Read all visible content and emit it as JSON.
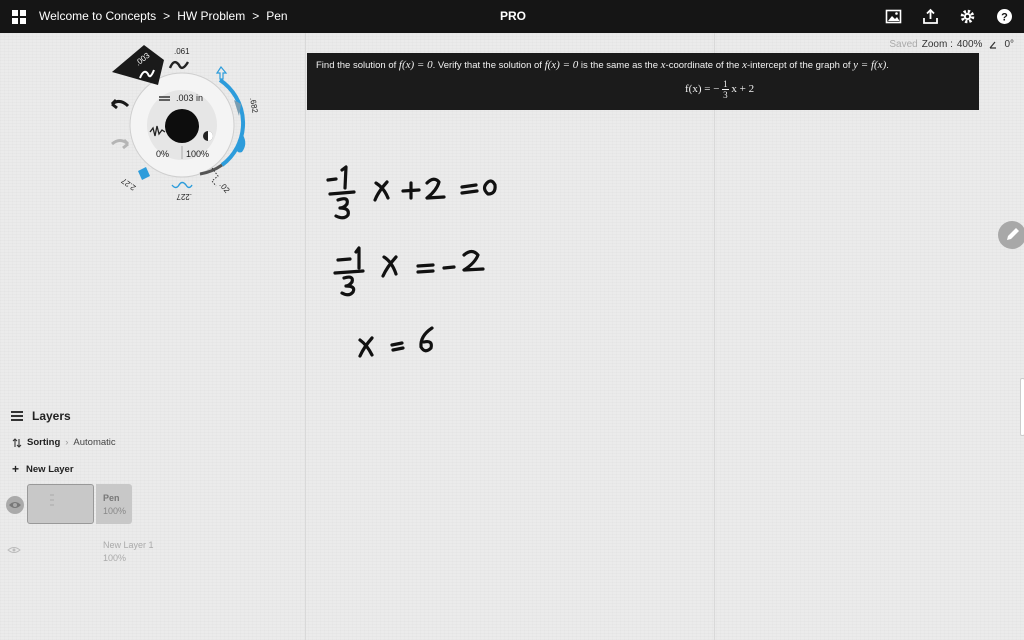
{
  "topbar": {
    "breadcrumb": [
      "Welcome to Concepts",
      "HW Problem",
      "Pen"
    ],
    "separator": ">",
    "pro_label": "PRO"
  },
  "status": {
    "saved": "Saved",
    "zoom_label": "Zoom :",
    "zoom_value": "400%",
    "rotation": "0°"
  },
  "problem": {
    "t1": "Find the solution of ",
    "m1": "f(x) = 0",
    "t2": ". Verify that the solution of ",
    "m2": "f(x) = 0",
    "t3": " is the same as the ",
    "m3": "x",
    "t4": "-coordinate of the ",
    "m4": "x",
    "t5": "-intercept of the graph of ",
    "m5": "y = f(x)",
    "t6": ".",
    "formula_lhs": "f(x) = −",
    "frac_num": "1",
    "frac_den": "3",
    "formula_rhs": "x + 2"
  },
  "wheel": {
    "size_top": ".003",
    "size_061": ".061",
    "size_in": ".003 in",
    "opacity_min": "0%",
    "opacity_max": "100%",
    "v682": ".682",
    "v227": ".227",
    "v227b": "2.27",
    "v02": ".02"
  },
  "layers": {
    "title": "Layers",
    "sorting_label": "Sorting",
    "sorting_value": "Automatic",
    "new_layer": "New Layer",
    "items": [
      {
        "name": "Pen",
        "opacity": "100%"
      },
      {
        "name": "New Layer 1",
        "opacity": "100%"
      }
    ]
  },
  "colors": {
    "accent": "#2d9cdb",
    "topbar": "#151515",
    "canvas": "#ebebeb"
  }
}
